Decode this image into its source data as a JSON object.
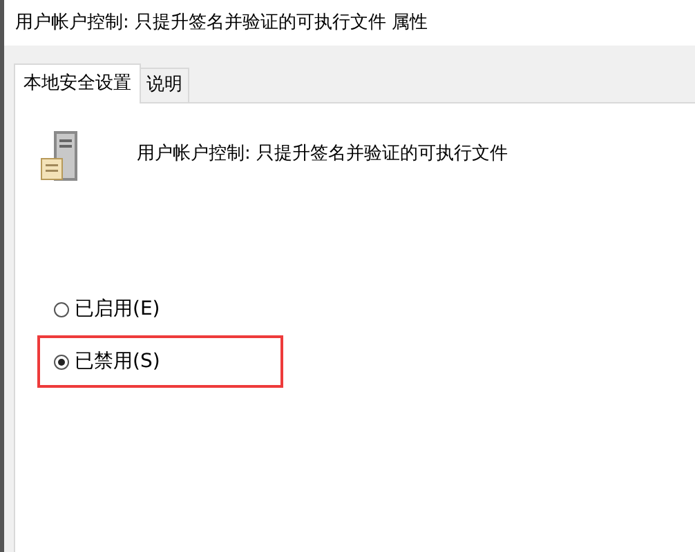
{
  "window": {
    "title": "用户帐户控制: 只提升签名并验证的可执行文件 属性"
  },
  "tabs": [
    {
      "label": "本地安全设置",
      "selected": true
    },
    {
      "label": "说明",
      "selected": false
    }
  ],
  "policy": {
    "name": "用户帐户控制: 只提升签名并验证的可执行文件"
  },
  "options": [
    {
      "label": "已启用(E)",
      "selected": false,
      "highlighted": false
    },
    {
      "label": "已禁用(S)",
      "selected": true,
      "highlighted": true
    }
  ]
}
